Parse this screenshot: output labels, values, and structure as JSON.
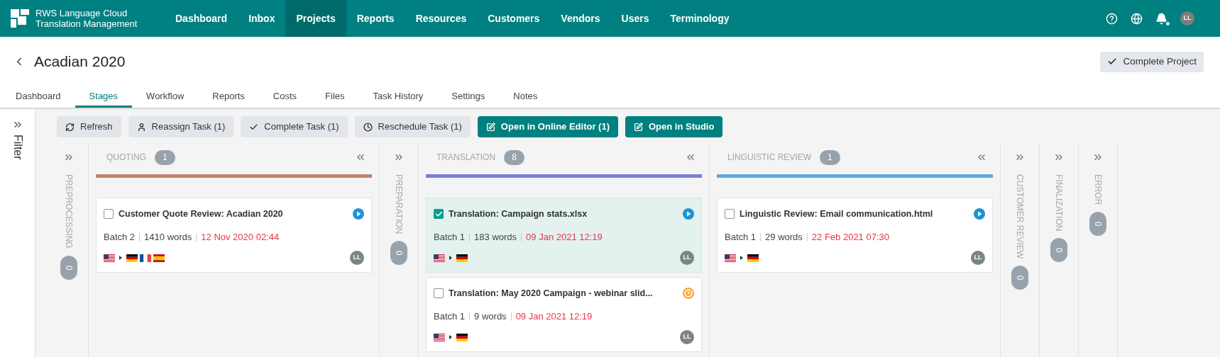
{
  "app": {
    "name_line1": "RWS Language Cloud",
    "name_line2": "Translation Management"
  },
  "nav": [
    {
      "label": "Dashboard",
      "selected": false
    },
    {
      "label": "Inbox",
      "selected": false
    },
    {
      "label": "Projects",
      "selected": true
    },
    {
      "label": "Reports",
      "selected": false
    },
    {
      "label": "Resources",
      "selected": false
    },
    {
      "label": "Customers",
      "selected": false
    },
    {
      "label": "Vendors",
      "selected": false
    },
    {
      "label": "Users",
      "selected": false
    },
    {
      "label": "Terminology",
      "selected": false
    }
  ],
  "notifications": {
    "unread": true
  },
  "user": {
    "initials": "LL"
  },
  "project": {
    "title": "Acadian 2020",
    "action": "Complete Project"
  },
  "tabs": [
    {
      "label": "Dashboard",
      "selected": false
    },
    {
      "label": "Stages",
      "selected": true
    },
    {
      "label": "Workflow",
      "selected": false
    },
    {
      "label": "Reports",
      "selected": false
    },
    {
      "label": "Costs",
      "selected": false
    },
    {
      "label": "Files",
      "selected": false
    },
    {
      "label": "Task History",
      "selected": false
    },
    {
      "label": "Settings",
      "selected": false
    },
    {
      "label": "Notes",
      "selected": false
    }
  ],
  "filter": {
    "label": "Filter"
  },
  "toolbar": [
    {
      "label": "Refresh",
      "kind": "secondary"
    },
    {
      "label": "Reassign Task (1)",
      "kind": "secondary"
    },
    {
      "label": "Complete Task (1)",
      "kind": "secondary"
    },
    {
      "label": "Reschedule Task (1)",
      "kind": "secondary"
    },
    {
      "label": "Open in Online Editor (1)",
      "kind": "primary"
    },
    {
      "label": "Open in Studio",
      "kind": "primary"
    }
  ],
  "stages": [
    {
      "kind": "collapsed",
      "name": "PREPROCESSING",
      "count": "0"
    },
    {
      "kind": "expanded",
      "name": "QUOTING",
      "count": "1",
      "color": "#c0846b",
      "tasks": [
        {
          "title": "Customer Quote Review: Acadian 2020",
          "checked": false,
          "selected": false,
          "kind": "play",
          "batch": "Batch 2",
          "words": "1410 words",
          "due": "12 Nov 2020 02:44",
          "source": {
            "kind": "us"
          },
          "targets": [
            {
              "kind": "de"
            },
            {
              "kind": "fr"
            },
            {
              "kind": "es"
            }
          ],
          "assignee": "LL"
        }
      ]
    },
    {
      "kind": "collapsed",
      "name": "PREPARATION",
      "count": "0"
    },
    {
      "kind": "expanded",
      "name": "TRANSLATION",
      "count": "8",
      "color": "#7b7fd9",
      "tasks": [
        {
          "title": "Translation: Campaign stats.xlsx",
          "checked": true,
          "selected": true,
          "kind": "play",
          "batch": "Batch 1",
          "words": "183 words",
          "due": "09 Jan 2021 12:19",
          "source": {
            "kind": "us"
          },
          "targets": [
            {
              "kind": "de"
            }
          ],
          "assignee": "LL"
        },
        {
          "title": "Translation: May 2020 Campaign - webinar slid...",
          "checked": false,
          "selected": false,
          "kind": "clock",
          "batch": "Batch 1",
          "words": "9 words",
          "due": "09 Jan 2021 12:19",
          "source": {
            "kind": "us"
          },
          "targets": [
            {
              "kind": "de"
            }
          ],
          "assignee": "LL"
        }
      ]
    },
    {
      "kind": "expanded",
      "name": "LINGUISTIC REVIEW",
      "count": "1",
      "color": "#5aa9e6",
      "tasks": [
        {
          "title": "Linguistic Review: Email communication.html",
          "checked": false,
          "selected": false,
          "kind": "play",
          "batch": "Batch 1",
          "words": "29 words",
          "due": "22 Feb 2021 07:30",
          "source": {
            "kind": "us"
          },
          "targets": [
            {
              "kind": "de"
            }
          ],
          "assignee": "LL"
        }
      ]
    },
    {
      "kind": "collapsed",
      "name": "CUSTOMER REVIEW",
      "count": "0"
    },
    {
      "kind": "collapsed",
      "name": "FINALIZATION",
      "count": "0"
    },
    {
      "kind": "collapsed",
      "name": "ERROR",
      "count": "0"
    }
  ]
}
